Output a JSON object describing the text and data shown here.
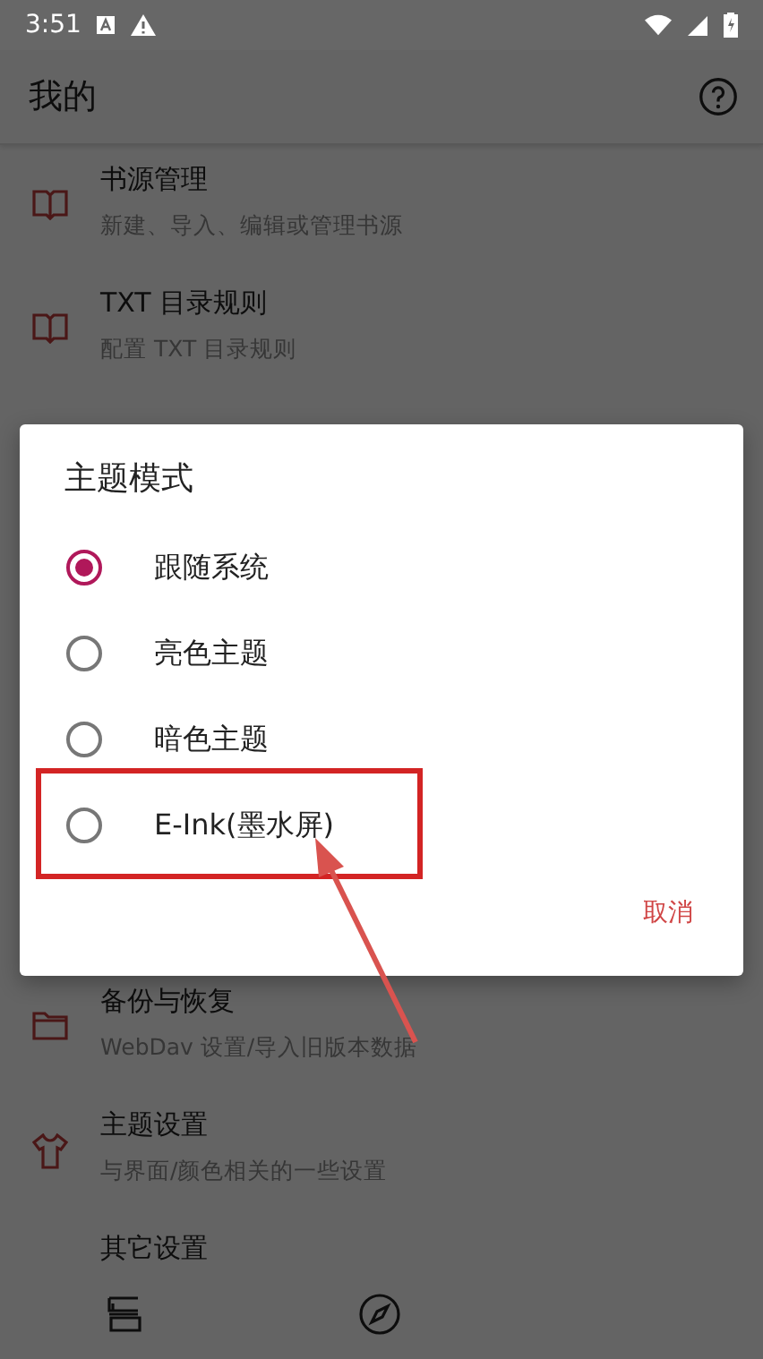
{
  "status_bar": {
    "time": "3:51"
  },
  "app_bar": {
    "title": "我的"
  },
  "items_top": [
    {
      "kind": "book",
      "title": "书源管理",
      "subtitle": "新建、导入、编辑或管理书源"
    },
    {
      "kind": "book",
      "title": "TXT 目录规则",
      "subtitle": "配置 TXT 目录规则"
    }
  ],
  "items_bottom": [
    {
      "kind": "folder",
      "title": "备份与恢复",
      "subtitle": "WebDav 设置/导入旧版本数据"
    },
    {
      "kind": "shirt",
      "title": "主题设置",
      "subtitle": "与界面/颜色相关的一些设置"
    },
    {
      "title": "其它设置"
    }
  ],
  "dialog": {
    "title": "主题模式",
    "options": [
      {
        "label": "跟随系统",
        "selected": true
      },
      {
        "label": "亮色主题",
        "selected": false
      },
      {
        "label": "暗色主题",
        "selected": false
      },
      {
        "label": "E-Ink(墨水屏)",
        "selected": false
      }
    ],
    "cancel": "取消"
  }
}
